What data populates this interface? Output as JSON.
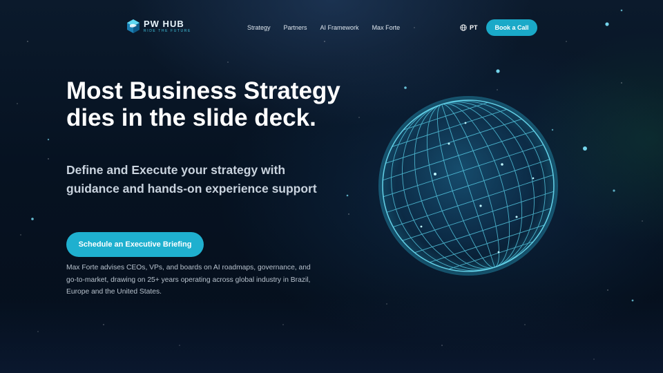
{
  "header": {
    "logo": {
      "title": "PW HUB",
      "tagline": "RIDE THE FUTURE"
    },
    "nav": [
      "Strategy",
      "Partners",
      "AI Framework",
      "Max Forte"
    ],
    "language": "PT",
    "book_call_label": "Book a Call"
  },
  "hero": {
    "title": "Most Business Strategy dies in the slide deck.",
    "subtitle": "Define and Execute your strategy with guidance and hands-on experience support",
    "cta_label": "Schedule an Executive Briefing",
    "description": "Max Forte advises CEOs, VPs, and boards on AI roadmaps, governance, and go-to-market, drawing on 25+ years operating across global industry in Brazil, Europe and the United States."
  },
  "colors": {
    "accent": "#1fb0cf",
    "background": "#061221",
    "globe": "#3fd4f0"
  },
  "icons": {
    "language": "globe-icon",
    "hero_visual": "wireframe-globe"
  }
}
